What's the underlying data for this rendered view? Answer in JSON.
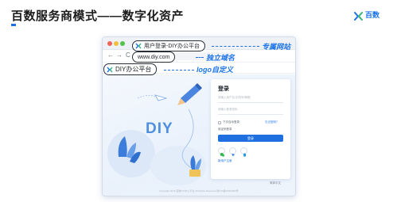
{
  "page": {
    "title": "百数服务商模式——数字化资产",
    "brand_name": "百数"
  },
  "browser": {
    "tab_title": "用户登录-DIY办公平台",
    "url": "www.diy.com",
    "bookmark": "DIY办公平台",
    "hero_text": "DIY"
  },
  "annotations": {
    "tab": "专属网站",
    "url": "独立域名",
    "logo": "logo自定义"
  },
  "login": {
    "title": "登录",
    "account_placeholder": "请输入用户名/手机号/邮箱",
    "password_placeholder": "请输入登录密码",
    "remember_label": "下次自动登录",
    "forgot_label": "忘记密码？",
    "sms_label": "验证码登录",
    "submit_label": "登录",
    "register_label": "新用户注册",
    "social_icons": [
      "wechat-icon",
      "dingtalk-icon",
      "qq-icon"
    ]
  },
  "footer": {
    "language": "简体中文",
    "copyright": "Copyright  2019  百数DIY办公平台  All Rights Reserved  浙ICP备00000000号"
  },
  "colors": {
    "accent": "#1f6fe0",
    "annotation": "#1a73e8"
  }
}
